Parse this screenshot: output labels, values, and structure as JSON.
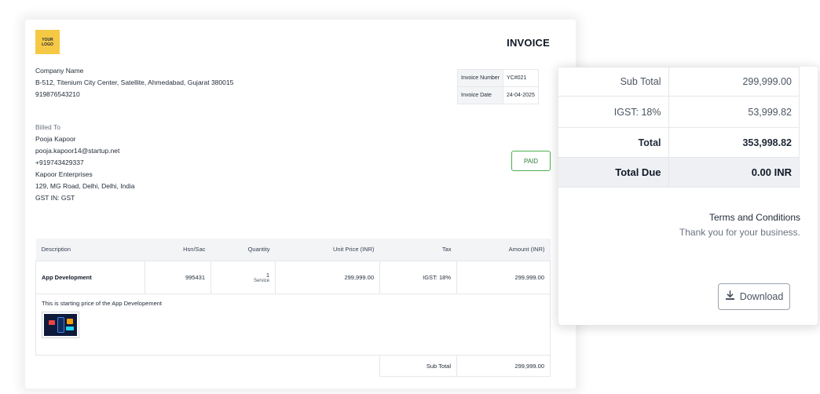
{
  "invoice": {
    "logo_line1": "YOUR",
    "logo_line2": "LOGO",
    "title": "INVOICE",
    "company": {
      "name": "Company Name",
      "address": "B-512, Titenium City Center, Satellite, Ahmedabad, Gujarat 380015",
      "phone": "919876543210"
    },
    "meta": {
      "number_label": "Invoice Number",
      "number_value": "YC#021",
      "date_label": "Invoice Date",
      "date_value": "24-04-2025"
    },
    "billed_to": {
      "header": "Billed To",
      "name": "Pooja Kapoor",
      "email": "pooja.kapoor14@startup.net",
      "phone": "+919743429337",
      "company": "Kapoor Enterprises",
      "address": "129, MG Road, Delhi, Delhi, India",
      "gst": "GST IN: GST"
    },
    "status": "PAID",
    "table": {
      "headers": [
        "Description",
        "Hsn/Sac",
        "Quantity",
        "Unit Price (INR)",
        "Tax",
        "Amount (INR)"
      ],
      "row": {
        "description": "App Development",
        "hsn": "995431",
        "quantity": "1",
        "unit": "Service",
        "unit_price": "299,999.00",
        "tax": "IGST: 18%",
        "amount": "299,999.00"
      },
      "note": "This is starting price of the App Developement"
    },
    "subtotal_label": "Sub Total",
    "subtotal_value": "299,999.00"
  },
  "summary": {
    "rows": [
      {
        "label": "Sub Total",
        "value": "299,999.00"
      },
      {
        "label": "IGST: 18%",
        "value": "53,999.82"
      },
      {
        "label": "Total",
        "value": "353,998.82"
      },
      {
        "label": "Total Due",
        "value": "0.00 INR"
      }
    ],
    "terms_title": "Terms and Conditions",
    "terms_text": "Thank you for your business.",
    "download_label": "Download",
    "download_icon": "download-icon"
  }
}
